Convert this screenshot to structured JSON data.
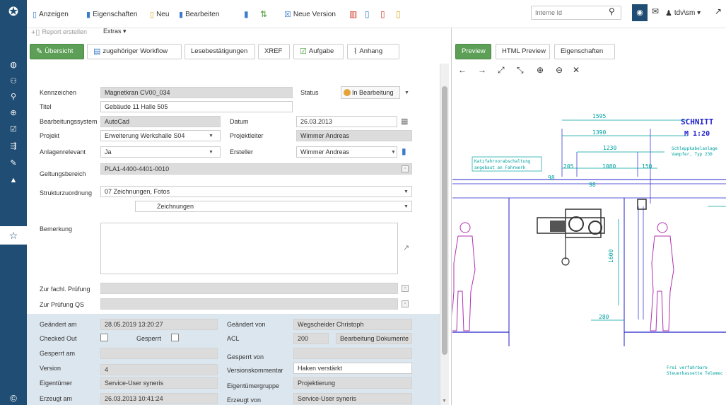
{
  "toolbar": {
    "anzeigen": "Anzeigen",
    "eigenschaften": "Eigenschaften",
    "neu": "Neu",
    "bearbeiten": "Bearbeiten",
    "neue_version": "Neue Version",
    "report_erstellen": "Report erstellen",
    "extras": "Extras ▾"
  },
  "header": {
    "search_placeholder": "Interne Id",
    "user": "tdv\\sm ▾"
  },
  "left_tabs": [
    "Übersicht",
    "zugehöriger Workflow",
    "Lesebestätigungen",
    "XREF",
    "Aufgabe",
    "Anhang"
  ],
  "right_tabs": [
    "Preview",
    "HTML Preview",
    "Eigenschaften"
  ],
  "form": {
    "kennzeichen_label": "Kennzeichen",
    "kennzeichen": "Magnetkran CV00_034",
    "status_label": "Status",
    "status": "In Bearbeitung",
    "titel_label": "Titel",
    "titel": "Gebäude 11  Halle 505",
    "bearbeitungssystem_label": "Bearbeitungssystem",
    "bearbeitungssystem": "AutoCad",
    "datum_label": "Datum",
    "datum": "26.03.2013",
    "projekt_label": "Projekt",
    "projekt": "Erweiterung Werkshalle S04",
    "projektleiter_label": "Projektleiter",
    "projektleiter": "Wimmer Andreas",
    "anlagenrelevant_label": "Anlagenrelevant",
    "anlagenrelevant": "Ja",
    "ersteller_label": "Ersteller",
    "ersteller": "Wimmer Andreas",
    "geltungsbereich_label": "Geltungsbereich",
    "geltungsbereich": "PLA1-4400-4401-0010",
    "strukturzuordnung_label": "Strukturzuordnung",
    "struktur1": "07 Zeichnungen, Fotos",
    "struktur2": "Zeichnungen",
    "bemerkung_label": "Bemerkung",
    "bemerkung": "",
    "fachl_pruefung_label": "Zur fachl. Prüfung",
    "pruefung_qs_label": "Zur Prüfung QS"
  },
  "meta": {
    "geaendert_am_label": "Geändert am",
    "geaendert_am": "28.05.2019 13:20:27",
    "geaendert_von_label": "Geändert von",
    "geaendert_von": "Wegscheider Christoph",
    "checked_out_label": "Checked Out",
    "gesperrt_label": "Gesperrt",
    "acl_label": "ACL",
    "acl_num": "200",
    "acl_name": "Bearbeitung Dokumente",
    "gesperrt_am_label": "Gesperrt am",
    "gesperrt_von_label": "Gesperrt von",
    "version_label": "Version",
    "version": "4",
    "versionskommentar_label": "Versionskommentar",
    "versionskommentar": "Haken verstärkt",
    "eigentuemer_label": "Eigentümer",
    "eigentuemer": "Service-User syneris",
    "eigentuemergruppe_label": "Eigentümergruppe",
    "eigentuemergruppe": "Projektierung",
    "erzeugt_am_label": "Erzeugt am",
    "erzeugt_am": "26.03.2013 10:41:24",
    "erzeugt_von_label": "Erzeugt von",
    "erzeugt_von": "Service-User syneris"
  },
  "drawing": {
    "title": "SCHNITT",
    "scale": "M 1:20",
    "dims": [
      "1595",
      "1390",
      "1230",
      "205",
      "1080",
      "150",
      "98",
      "98",
      "1600",
      "280"
    ],
    "note1_line1": "Katzfahrvorabschaltung",
    "note1_line2": "angebaut an Fahrwerk",
    "note2_line1": "Schleppkabelanlage",
    "note2_line2": "Vampfer, Typ 230",
    "note3_line1": "Frei verfahrbare",
    "note3_line2": "Steuerkassette Telemec"
  },
  "icons": {
    "logo": "app-logo-icon",
    "sidebar": [
      "dashboard-icon",
      "hierarchy-icon",
      "search-icon",
      "search-plus-icon",
      "check-square-icon",
      "share-icon",
      "pencil-icon",
      "graduation-cap-icon",
      "star-icon",
      "copyright-icon"
    ],
    "preview_tools": [
      "arrow-left-icon",
      "arrow-right-icon",
      "expand-icon",
      "compress-icon",
      "zoom-in-icon",
      "zoom-out-icon",
      "fullscreen-icon"
    ]
  },
  "colors": {
    "sidebar": "#1f4d73",
    "tab_active": "#5d9f56",
    "readonly": "#dcdcdc",
    "meta_bg": "#dce6ee",
    "drawing_blue": "#2222cc",
    "drawing_cyan": "#00a0a0",
    "drawing_magenta": "#b030b0"
  }
}
